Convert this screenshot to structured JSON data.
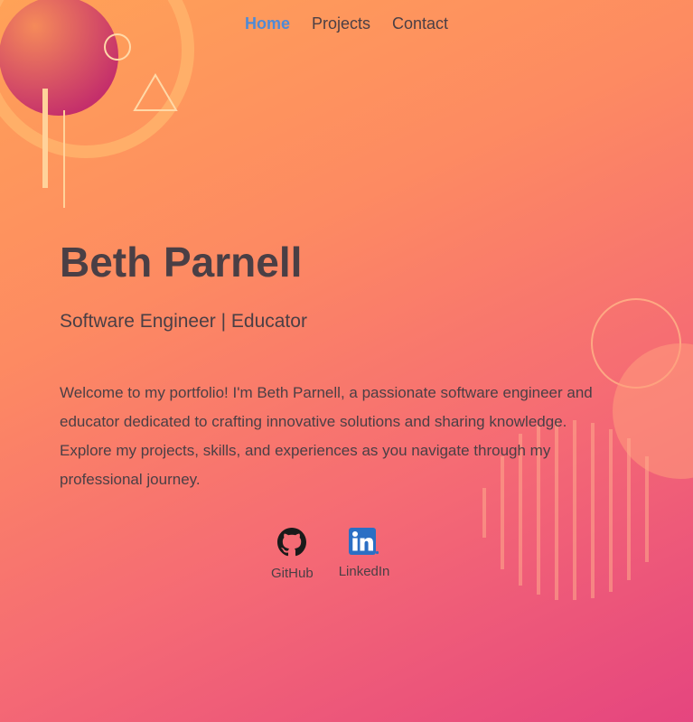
{
  "nav": {
    "home": "Home",
    "projects": "Projects",
    "contact": "Contact"
  },
  "hero": {
    "name": "Beth Parnell",
    "tagline": "Software Engineer | Educator",
    "intro": "Welcome to my portfolio! I'm Beth Parnell, a passionate software engineer and educator dedicated to crafting innovative solutions and sharing knowledge. Explore my projects, skills, and experiences as you navigate through my professional journey."
  },
  "social": {
    "github": {
      "label": "GitHub",
      "icon": "github-icon"
    },
    "linkedin": {
      "label": "LinkedIn",
      "icon": "linkedin-icon"
    }
  },
  "colors": {
    "background_start": "#ffa257",
    "background_end": "#e5457f",
    "active_link": "#4f8ad6",
    "text": "#4a3f45",
    "linkedin_blue": "#2b6fc4"
  }
}
